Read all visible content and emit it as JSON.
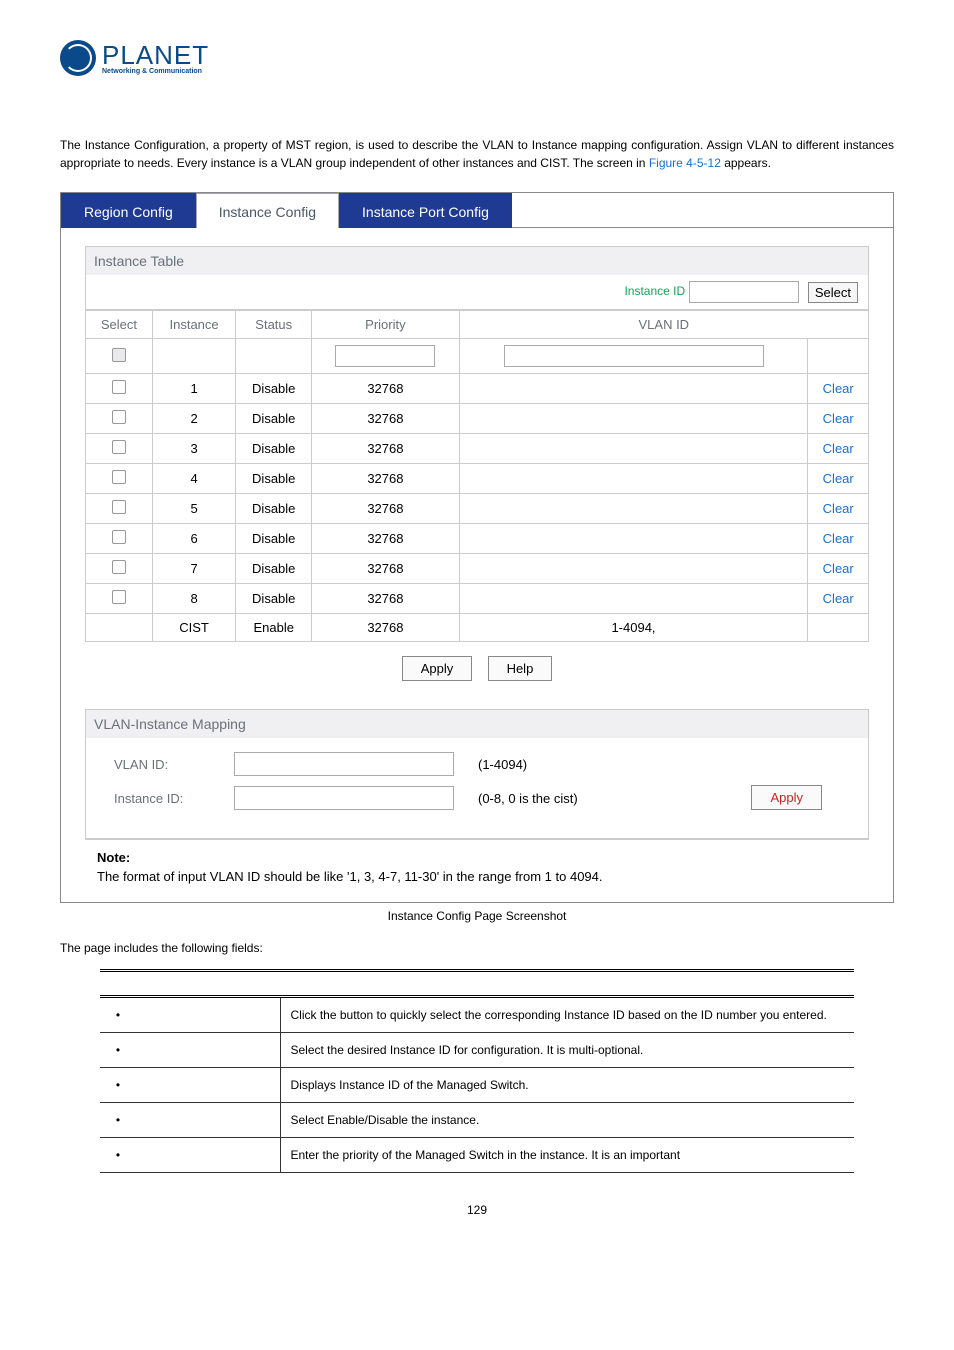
{
  "logo": {
    "brand": "PLANET",
    "subtitle": "Networking & Communication"
  },
  "intro": {
    "l1": "The Instance Configuration, a property of MST region, is used to describe the VLAN to Instance mapping configuration. Assign",
    "l2": "VLAN to different instances appropriate to needs. Every instance is a VLAN group independent of other instances and CIST.",
    "l3a": "The screen in ",
    "l3link": "Figure 4-5-12",
    "l3b": " appears."
  },
  "tabs": {
    "region": "Region Config",
    "instance": "Instance Config",
    "port": "Instance Port Config"
  },
  "tableTop": {
    "title": "Instance Table",
    "instanceIdLabel": "Instance ID",
    "selectBtn": "Select"
  },
  "headers": {
    "select": "Select",
    "instance": "Instance",
    "status": "Status",
    "priority": "Priority",
    "vlan": "VLAN ID"
  },
  "rows": [
    {
      "inst": "1",
      "status": "Disable",
      "prio": "32768",
      "vlan": "",
      "act": "Clear"
    },
    {
      "inst": "2",
      "status": "Disable",
      "prio": "32768",
      "vlan": "",
      "act": "Clear"
    },
    {
      "inst": "3",
      "status": "Disable",
      "prio": "32768",
      "vlan": "",
      "act": "Clear"
    },
    {
      "inst": "4",
      "status": "Disable",
      "prio": "32768",
      "vlan": "",
      "act": "Clear"
    },
    {
      "inst": "5",
      "status": "Disable",
      "prio": "32768",
      "vlan": "",
      "act": "Clear"
    },
    {
      "inst": "6",
      "status": "Disable",
      "prio": "32768",
      "vlan": "",
      "act": "Clear"
    },
    {
      "inst": "7",
      "status": "Disable",
      "prio": "32768",
      "vlan": "",
      "act": "Clear"
    },
    {
      "inst": "8",
      "status": "Disable",
      "prio": "32768",
      "vlan": "",
      "act": "Clear"
    }
  ],
  "cistRow": {
    "inst": "CIST",
    "status": "Enable",
    "prio": "32768",
    "vlan": "1-4094,"
  },
  "buttons": {
    "apply": "Apply",
    "help": "Help"
  },
  "mapping": {
    "title": "VLAN-Instance Mapping",
    "vlanLabel": "VLAN ID:",
    "vlanHint": "(1-4094)",
    "instLabel": "Instance ID:",
    "instHint": "(0-8, 0 is the cist)",
    "apply": "Apply"
  },
  "note": {
    "title": "Note:",
    "text": "The format of input VLAN ID should be like '1, 3, 4-7, 11-30' in the range from 1 to 4094."
  },
  "caption": "Instance Config Page Screenshot",
  "fieldsIntro": "The page includes the following fields:",
  "objRows": [
    {
      "d1": "Click the ",
      "d2": " button to quickly select the corresponding Instance ID based on the ID number you entered."
    },
    {
      "d": "Select the desired Instance ID for configuration. It is multi-optional."
    },
    {
      "d": "Displays Instance ID of the Managed Switch."
    },
    {
      "d": "Select Enable/Disable the instance."
    },
    {
      "d": "Enter the priority of the Managed Switch in the instance. It is an important"
    }
  ],
  "pageNumber": "129"
}
